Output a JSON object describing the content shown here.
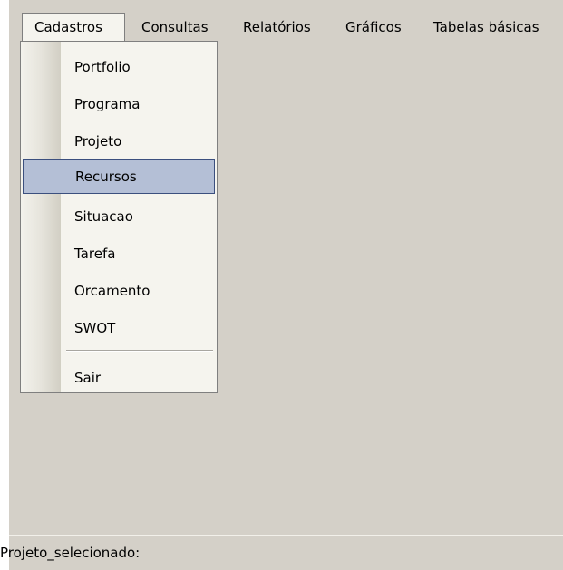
{
  "menubar": {
    "menus": [
      {
        "label": "Cadastros"
      },
      {
        "label": "Consultas"
      },
      {
        "label": "Relatórios"
      },
      {
        "label": "Gráficos"
      },
      {
        "label": "Tabelas básicas"
      }
    ]
  },
  "dropdown": {
    "items": [
      {
        "label": "Portfolio"
      },
      {
        "label": "Programa"
      },
      {
        "label": "Projeto"
      },
      {
        "label": "Recursos"
      },
      {
        "label": "Situacao"
      },
      {
        "label": "Tarefa"
      },
      {
        "label": "Orcamento"
      },
      {
        "label": "SWOT"
      },
      {
        "label": "Sair"
      }
    ],
    "highlighted": "Recursos"
  },
  "statusbar": {
    "label": "Projeto_selecionado:"
  }
}
